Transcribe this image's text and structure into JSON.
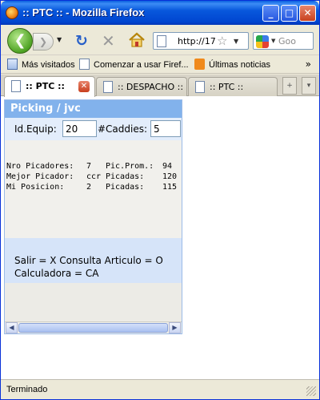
{
  "window": {
    "title": ":: PTC :: - Mozilla Firefox",
    "controls": {
      "minimize": "_",
      "maximize": "□",
      "close": "✕"
    }
  },
  "nav": {
    "back_glyph": "❮",
    "forward_glyph": "❯",
    "reload_glyph": "↻",
    "stop_glyph": "✕",
    "url": "http://17",
    "star_glyph": "☆",
    "search_placeholder": "Goo"
  },
  "bookmarks": [
    {
      "label": "Más visitados",
      "icon": "most-visited-icon"
    },
    {
      "label": "Comenzar a usar Firef...",
      "icon": "page-icon"
    },
    {
      "label": "Últimas noticias",
      "icon": "rss-icon"
    }
  ],
  "bookmarks_more": "»",
  "tabs": [
    {
      "label": ":: PTC ::",
      "active": true
    },
    {
      "label": ":: DESPACHO ::",
      "active": false
    },
    {
      "label": ":: PTC ::",
      "active": false
    }
  ],
  "tab_close_glyph": "✕",
  "tab_scroll_glyph": "+",
  "tab_list_glyph": "▾",
  "app": {
    "title": "Picking / jvc",
    "equip_label": "Id.Equip:",
    "equip_value": "20",
    "caddies_label": "#Caddies:",
    "caddies_value": "5",
    "stats": [
      {
        "label": "Nro Picadores:",
        "value": "7",
        "label2": "Pic.Prom.:",
        "value2": "94"
      },
      {
        "label": "Mejor Picador:",
        "value": "ccr",
        "label2": "Picadas:",
        "value2": "120"
      },
      {
        "label": "Mi Posicion:",
        "value": "2",
        "label2": "Picadas:",
        "value2": "115"
      }
    ],
    "footer_line1": "Salir = X Consulta Articulo = O",
    "footer_line2": "Calculadora = CA"
  },
  "scroll": {
    "left": "◀",
    "right": "▶"
  },
  "status": {
    "text": "Terminado"
  },
  "colors": {
    "titlebar": "#0858dc",
    "app_header": "#82b2ec",
    "form_row": "#e3edfb",
    "footer_panel": "#d6e4f9"
  }
}
